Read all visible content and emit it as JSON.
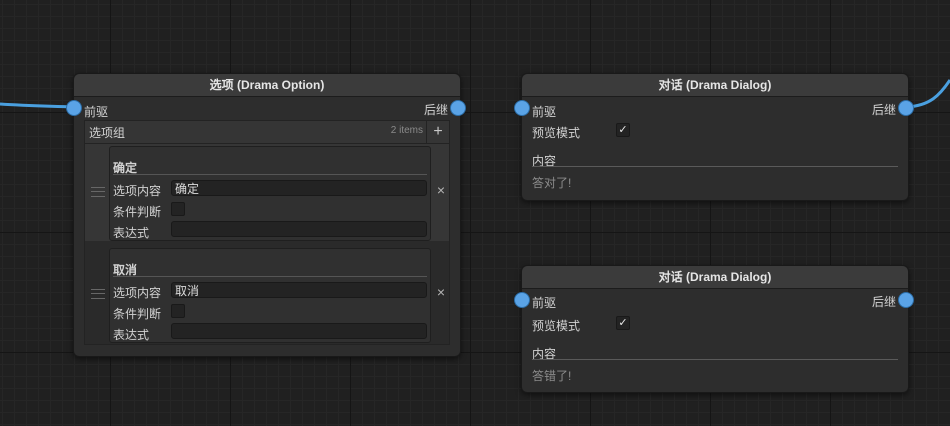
{
  "colors": {
    "port": "#5aa3e6",
    "wire": "#4aa0e0",
    "node_bg": "#2d2d2d",
    "title_bg": "#3b3b3b"
  },
  "option_node": {
    "title": "选项 (Drama Option)",
    "input_port": "前驱",
    "output_port": "后继",
    "group": {
      "label": "选项组",
      "count": "2 items",
      "add_icon": "plus-icon"
    },
    "items": [
      {
        "title": "确定",
        "content_label": "选项内容",
        "content_value": "确定",
        "condition_label": "条件判断",
        "condition_checked": false,
        "expression_label": "表达式",
        "expression_value": ""
      },
      {
        "title": "取消",
        "content_label": "选项内容",
        "content_value": "取消",
        "condition_label": "条件判断",
        "condition_checked": false,
        "expression_label": "表达式",
        "expression_value": ""
      }
    ],
    "remove_icon": "×"
  },
  "dialog_nodes": [
    {
      "title": "对话 (Drama Dialog)",
      "input_port": "前驱",
      "output_port": "后继",
      "preview_label": "预览模式",
      "preview_checked": true,
      "check_glyph": "✓",
      "content_label": "内容",
      "content_text": "答对了!"
    },
    {
      "title": "对话 (Drama Dialog)",
      "input_port": "前驱",
      "output_port": "后继",
      "preview_label": "预览模式",
      "preview_checked": true,
      "check_glyph": "✓",
      "content_label": "内容",
      "content_text": "答错了!"
    }
  ]
}
